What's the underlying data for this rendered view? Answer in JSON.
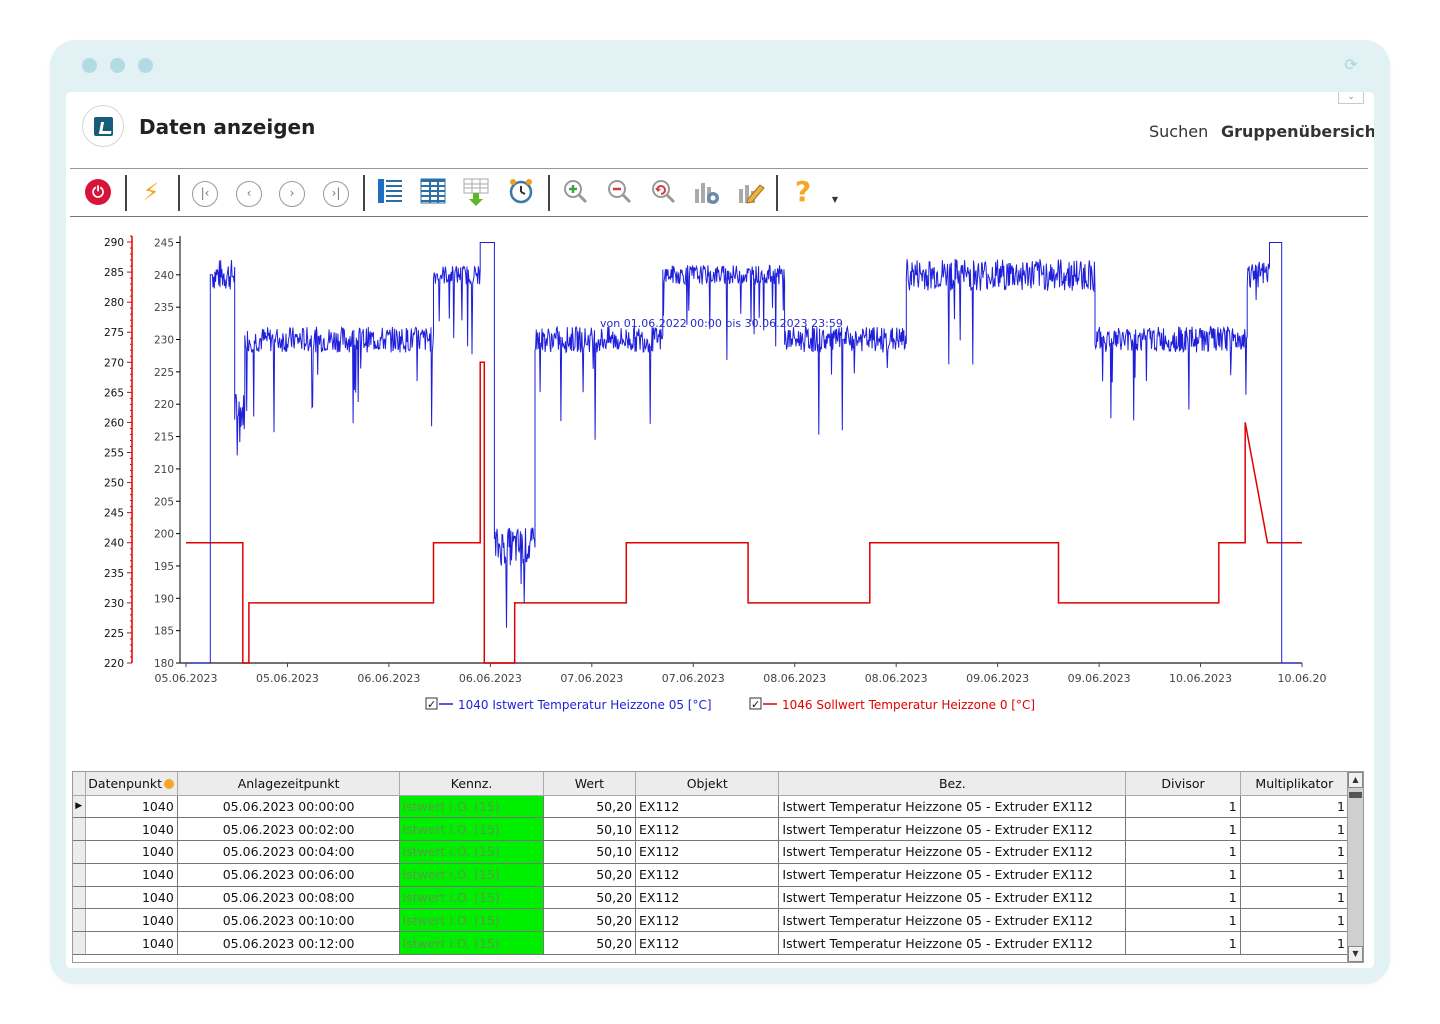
{
  "window": {
    "title": "Daten anzeigen",
    "nav": [
      "Suchen",
      "Gruppenübersicht"
    ],
    "active_nav": "Gruppenübersicht"
  },
  "toolbar": {
    "buttons": [
      {
        "name": "power-icon"
      },
      {
        "name": "lightning-icon"
      },
      {
        "name": "first-page-icon"
      },
      {
        "name": "prev-page-icon"
      },
      {
        "name": "next-page-icon"
      },
      {
        "name": "last-page-icon"
      },
      {
        "name": "list-view-icon"
      },
      {
        "name": "table-view-icon"
      },
      {
        "name": "export-table-icon"
      },
      {
        "name": "alarm-clock-icon"
      },
      {
        "name": "zoom-in-icon"
      },
      {
        "name": "zoom-out-icon"
      },
      {
        "name": "zoom-reset-icon"
      },
      {
        "name": "chart-settings-icon"
      },
      {
        "name": "edit-chart-icon"
      },
      {
        "name": "help-icon"
      },
      {
        "name": "dropdown-arrow-icon"
      }
    ]
  },
  "chart_data": {
    "type": "line",
    "subtitle": "von  01.06.2022 00:00  bis  30.06.2023 23:59",
    "x_ticks": [
      "05.06.2023",
      "05.06.2023",
      "06.06.2023",
      "06.06.2023",
      "07.06.2023",
      "07.06.2023",
      "08.06.2023",
      "08.06.2023",
      "09.06.2023",
      "09.06.2023",
      "10.06.2023",
      "10.06.20"
    ],
    "x_range": [
      0,
      5.5
    ],
    "y_right_axis": {
      "ticks": [
        180,
        185,
        190,
        195,
        200,
        205,
        210,
        215,
        220,
        225,
        230,
        235,
        240,
        245
      ],
      "range": [
        180,
        246
      ],
      "color": "#000000"
    },
    "y_left_axis": {
      "ticks": [
        220,
        225,
        230,
        235,
        240,
        245,
        250,
        255,
        260,
        265,
        270,
        275,
        280,
        285,
        290
      ],
      "range": [
        220,
        291
      ],
      "color": "#e00000"
    },
    "series": [
      {
        "name": "1040 Istwert Temperatur Heizzone 05 [°C]",
        "color": "#1f1fdb",
        "axis": "right",
        "segments": [
          {
            "x0": 0.0,
            "x1": 0.12,
            "level": 0
          },
          {
            "x0": 0.12,
            "x1": 0.13,
            "level": 240
          },
          {
            "x0": 0.13,
            "x1": 0.24,
            "level": 240,
            "noise": 2.5
          },
          {
            "x0": 0.24,
            "x1": 0.29,
            "level": 219,
            "noise": 3
          },
          {
            "x0": 0.29,
            "x1": 1.22,
            "level": 230,
            "noise": 2
          },
          {
            "x0": 1.22,
            "x1": 1.45,
            "level": 240,
            "noise": 1.5
          },
          {
            "x0": 1.45,
            "x1": 1.52,
            "level": 245
          },
          {
            "x0": 1.52,
            "x1": 1.72,
            "level": 198,
            "noise": 3
          },
          {
            "x0": 1.72,
            "x1": 2.35,
            "level": 230,
            "noise": 2
          },
          {
            "x0": 2.35,
            "x1": 2.95,
            "level": 240,
            "noise": 1.5
          },
          {
            "x0": 2.95,
            "x1": 3.55,
            "level": 230,
            "noise": 2
          },
          {
            "x0": 3.55,
            "x1": 4.48,
            "level": 240,
            "noise": 2.5
          },
          {
            "x0": 4.48,
            "x1": 5.23,
            "level": 230,
            "noise": 2
          },
          {
            "x0": 5.23,
            "x1": 5.34,
            "level": 240,
            "noise": 2
          },
          {
            "x0": 5.34,
            "x1": 5.4,
            "level": 245
          },
          {
            "x0": 5.4,
            "x1": 5.5,
            "level": 0
          }
        ]
      },
      {
        "name": "1046 Sollwert Temperatur Heizzone 0 [°C]",
        "color": "#e00000",
        "axis": "left",
        "points": [
          [
            0.0,
            240
          ],
          [
            0.28,
            240
          ],
          [
            0.28,
            220
          ],
          [
            0.31,
            220
          ],
          [
            0.31,
            230
          ],
          [
            1.22,
            230
          ],
          [
            1.22,
            240
          ],
          [
            1.45,
            240
          ],
          [
            1.45,
            270
          ],
          [
            1.47,
            270
          ],
          [
            1.47,
            220
          ],
          [
            1.62,
            220
          ],
          [
            1.62,
            230
          ],
          [
            2.17,
            230
          ],
          [
            2.17,
            240
          ],
          [
            2.77,
            240
          ],
          [
            2.77,
            230
          ],
          [
            3.37,
            230
          ],
          [
            3.37,
            240
          ],
          [
            4.3,
            240
          ],
          [
            4.3,
            230
          ],
          [
            5.09,
            230
          ],
          [
            5.09,
            240
          ],
          [
            5.22,
            240
          ],
          [
            5.22,
            260
          ],
          [
            5.33,
            240
          ],
          [
            5.5,
            240
          ]
        ]
      }
    ]
  },
  "legend": [
    {
      "label": "1040 Istwert Temperatur Heizzone 05 [°C]",
      "checked": true
    },
    {
      "label": "1046 Sollwert Temperatur Heizzone 0 [°C]",
      "checked": true
    }
  ],
  "table": {
    "columns": [
      "Datenpunkt",
      "Anlagezeitpunkt",
      "Kennz.",
      "Wert",
      "Objekt",
      "Bez.",
      "Divisor",
      "Multiplikator"
    ],
    "rows": [
      [
        "1040",
        "05.06.2023 00:00:00",
        "Istwert i.O. (15)",
        "50,20",
        "EX112",
        "Istwert Temperatur Heizzone 05 - Extruder EX112",
        "1",
        "1"
      ],
      [
        "1040",
        "05.06.2023 00:02:00",
        "Istwert i.O. (15)",
        "50,10",
        "EX112",
        "Istwert Temperatur Heizzone 05 - Extruder EX112",
        "1",
        "1"
      ],
      [
        "1040",
        "05.06.2023 00:04:00",
        "Istwert i.O. (15)",
        "50,10",
        "EX112",
        "Istwert Temperatur Heizzone 05 - Extruder EX112",
        "1",
        "1"
      ],
      [
        "1040",
        "05.06.2023 00:06:00",
        "Istwert i.O. (15)",
        "50,20",
        "EX112",
        "Istwert Temperatur Heizzone 05 - Extruder EX112",
        "1",
        "1"
      ],
      [
        "1040",
        "05.06.2023 00:08:00",
        "Istwert i.O. (15)",
        "50,20",
        "EX112",
        "Istwert Temperatur Heizzone 05 - Extruder EX112",
        "1",
        "1"
      ],
      [
        "1040",
        "05.06.2023 00:10:00",
        "Istwert i.O. (15)",
        "50,20",
        "EX112",
        "Istwert Temperatur Heizzone 05 - Extruder EX112",
        "1",
        "1"
      ],
      [
        "1040",
        "05.06.2023 00:12:00",
        "Istwert i.O. (15)",
        "50,20",
        "EX112",
        "Istwert Temperatur Heizzone 05 - Extruder EX112",
        "1",
        "1"
      ]
    ]
  }
}
